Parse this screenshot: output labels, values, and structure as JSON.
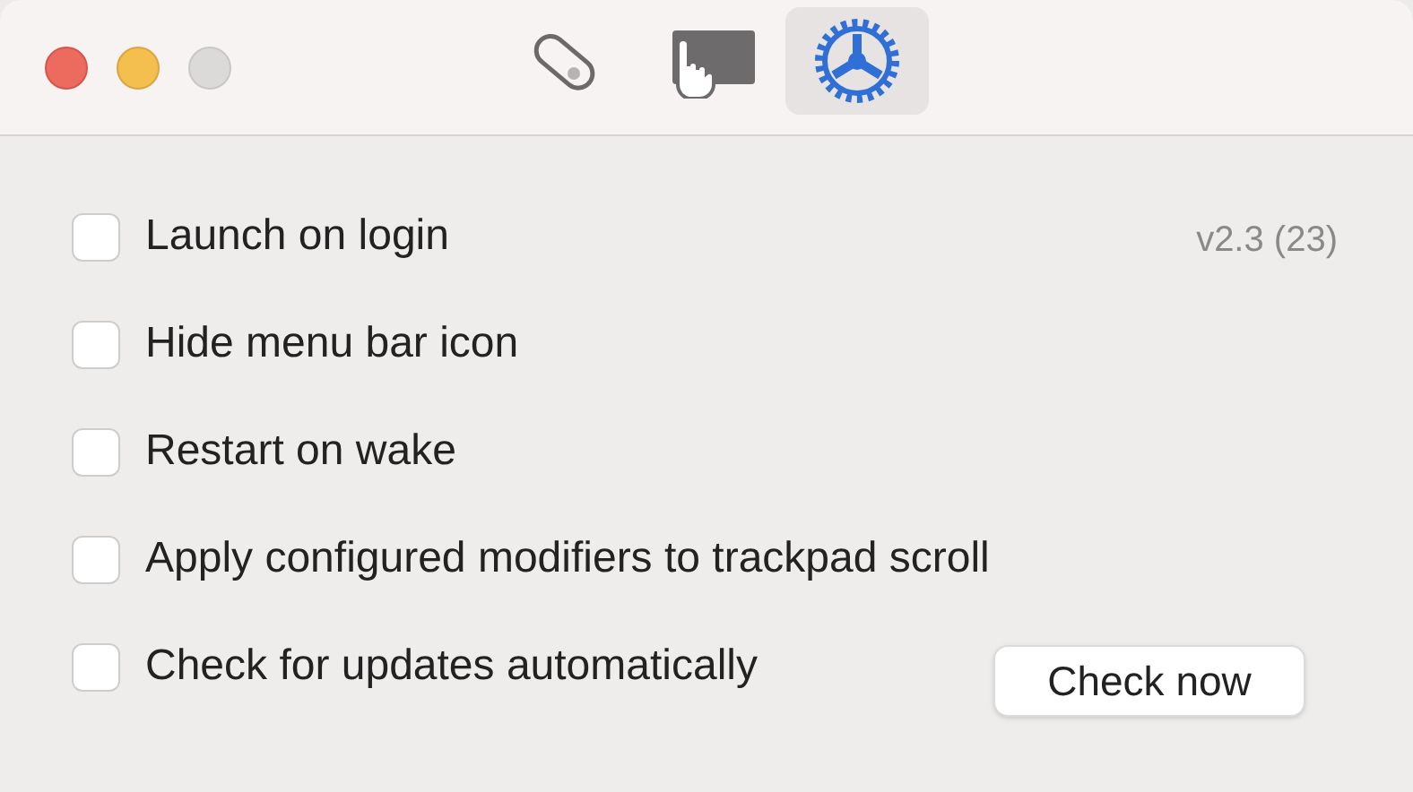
{
  "window": {
    "controls": [
      {
        "kind": "close"
      },
      {
        "kind": "minimize"
      },
      {
        "kind": "zoom"
      }
    ]
  },
  "tabs": [
    {
      "kind": "tag",
      "selected": false
    },
    {
      "kind": "trackpad",
      "selected": false
    },
    {
      "kind": "gear",
      "selected": true
    }
  ],
  "version": "v2.3 (23)",
  "options": [
    {
      "label": "Launch on login",
      "checked": false
    },
    {
      "label": "Hide menu bar icon",
      "checked": false
    },
    {
      "label": "Restart on wake",
      "checked": false
    },
    {
      "label": "Apply configured modifiers to trackpad scroll",
      "checked": false
    },
    {
      "label": "Check for updates automatically",
      "checked": false
    }
  ],
  "check_button": "Check now"
}
